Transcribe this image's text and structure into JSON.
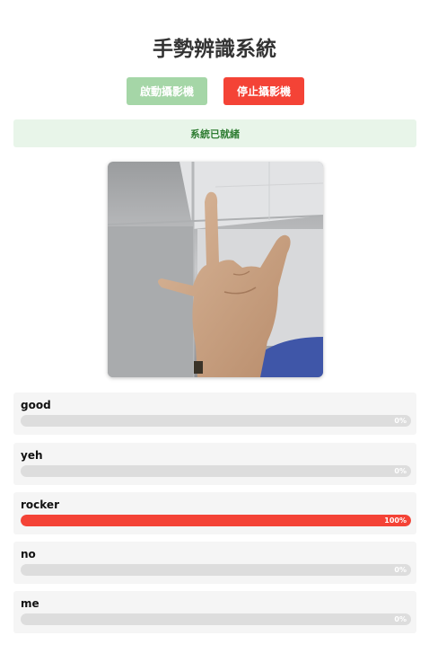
{
  "app": {
    "title": "手勢辨識系統"
  },
  "controls": {
    "start_label": "啟動攝影機",
    "stop_label": "停止攝影機"
  },
  "status": {
    "text": "系統已就緒",
    "color": "#2e7d32",
    "background": "#e8f5e9"
  },
  "camera": {
    "content": "live webcam frame showing a hand gesture"
  },
  "colors": {
    "start": "#a5d6a7",
    "stop": "#f44336",
    "fill": "#f44336",
    "track": "#dddddd"
  },
  "gestures": [
    {
      "label": "good",
      "percent_text": "0%",
      "value": 0
    },
    {
      "label": "yeh",
      "percent_text": "0%",
      "value": 0
    },
    {
      "label": "rocker",
      "percent_text": "100%",
      "value": 100
    },
    {
      "label": "no",
      "percent_text": "0%",
      "value": 0
    },
    {
      "label": "me",
      "percent_text": "0%",
      "value": 0
    }
  ]
}
